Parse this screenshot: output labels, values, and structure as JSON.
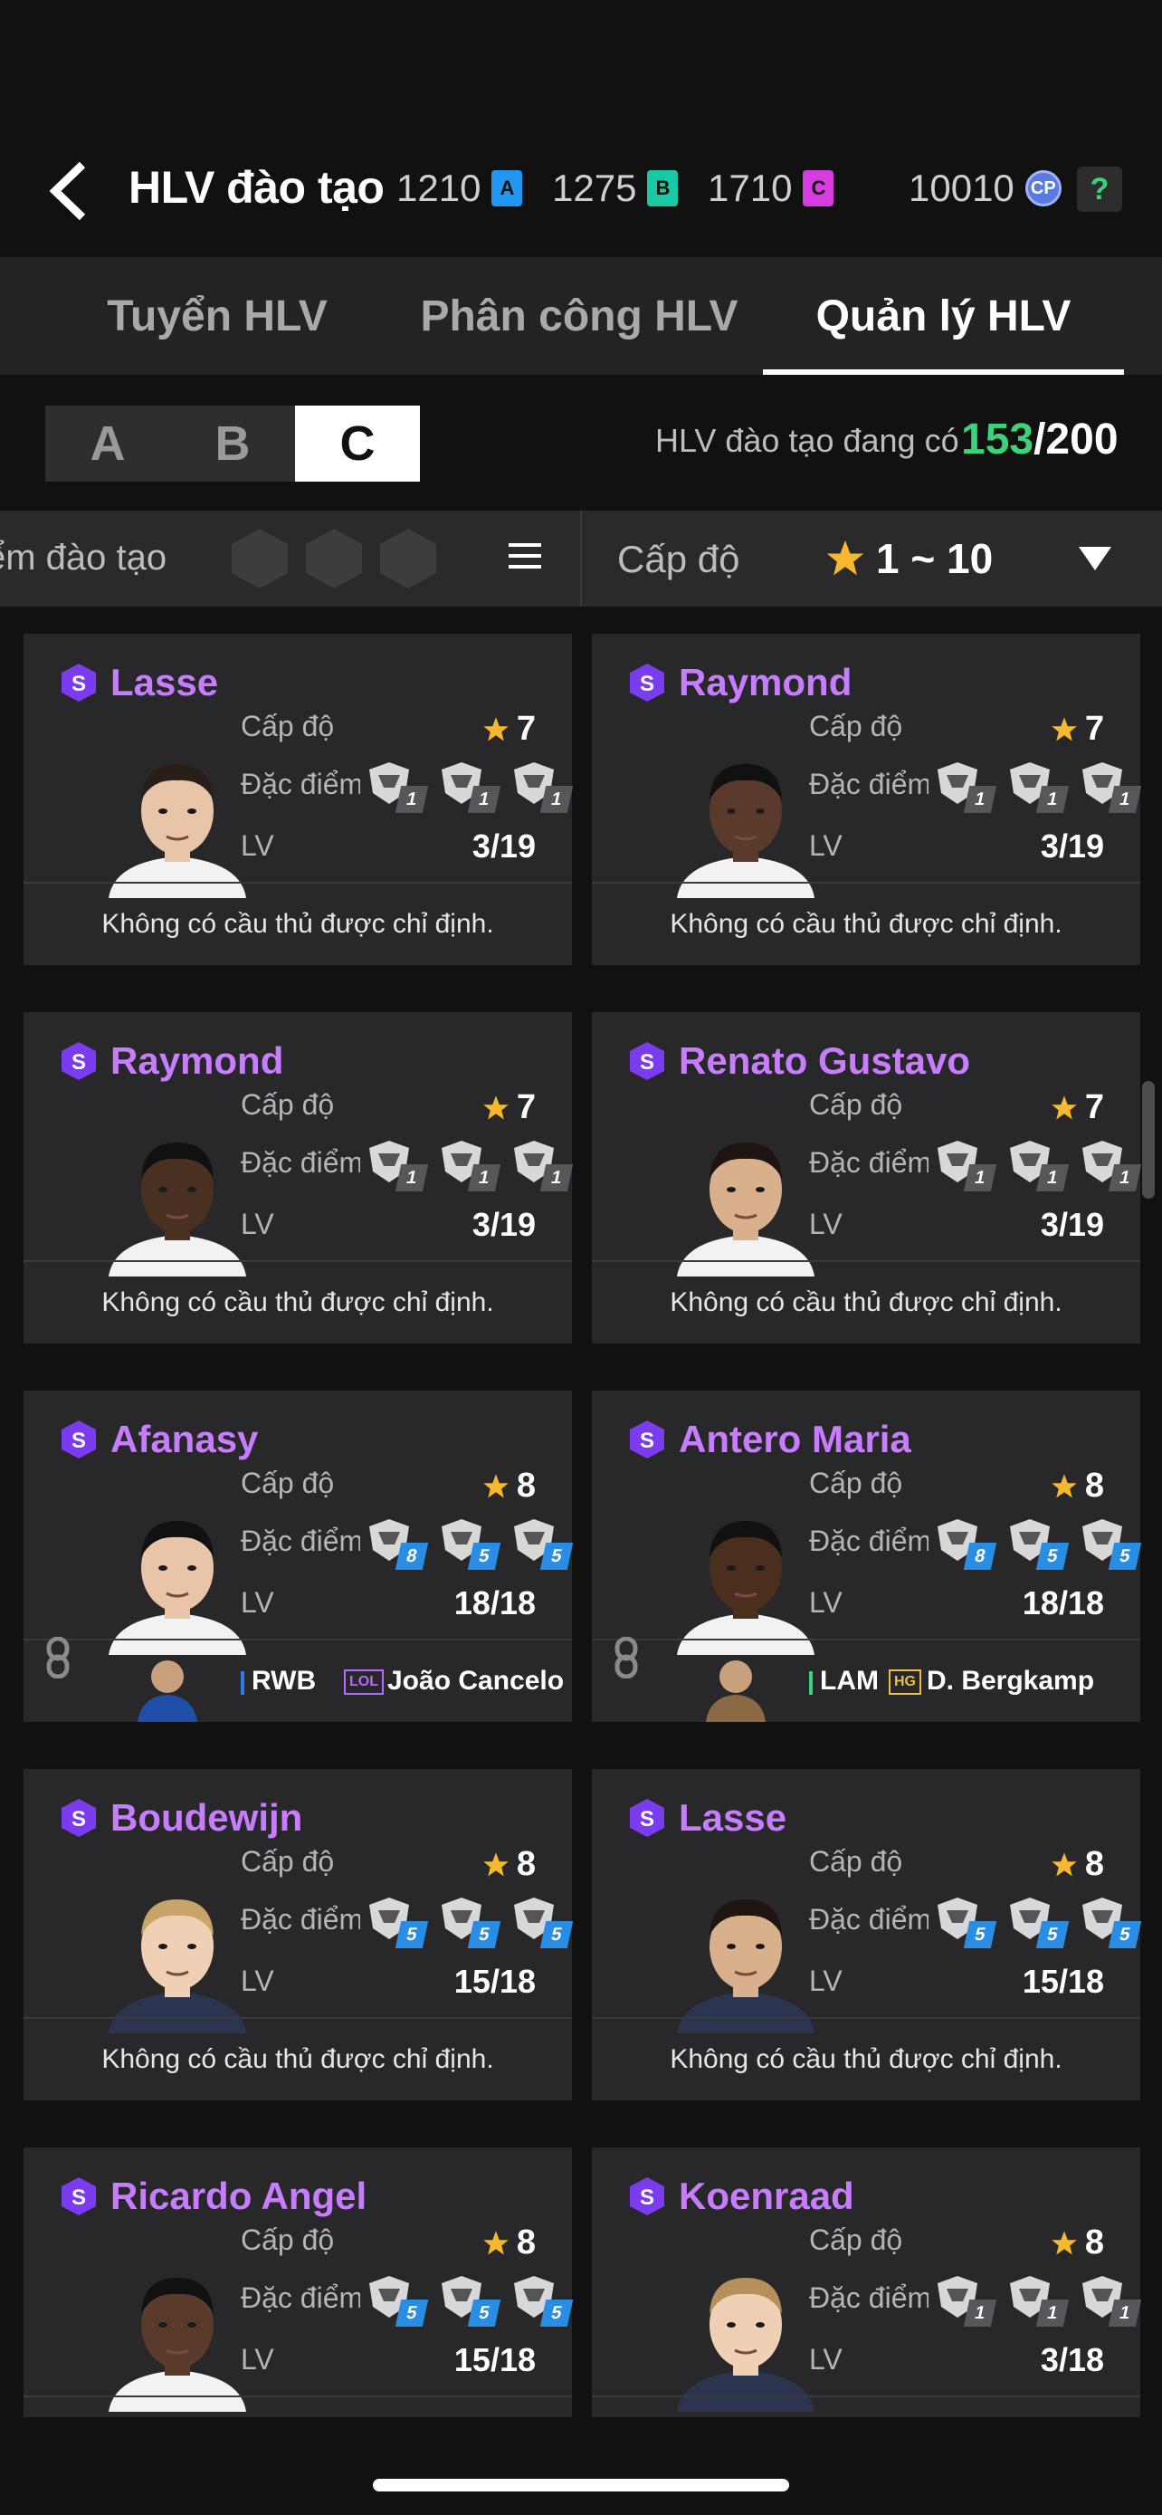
{
  "header": {
    "title": "HLV đào tạo",
    "currencies": [
      {
        "value": "1210",
        "badge": "A",
        "color": "#2196f3"
      },
      {
        "value": "1275",
        "badge": "B",
        "color": "#19c9a5"
      },
      {
        "value": "1710",
        "badge": "C",
        "color": "#d63ce0"
      },
      {
        "value": "10010",
        "badge": "CP",
        "color": "#5b7ae0"
      }
    ],
    "help": "?"
  },
  "tabs": [
    {
      "label": "Tuyển HLV",
      "active": false
    },
    {
      "label": "Phân công HLV",
      "active": false
    },
    {
      "label": "Quản lý HLV",
      "active": true
    }
  ],
  "grade_filter": {
    "options": [
      "A",
      "B",
      "C"
    ],
    "selected": "C"
  },
  "coach_count": {
    "label": "HLV đào tạo đang có",
    "current": "153",
    "max": "/200"
  },
  "filter": {
    "label": "ểm đào tạo",
    "level_label": "Cấp độ",
    "level_range": "1 ~ 10"
  },
  "stat_labels": {
    "level": "Cấp độ",
    "traits": "Đặc điểm",
    "lv": "LV"
  },
  "empty_assignment": "Không có cầu thủ được chỉ định.",
  "cards": [
    {
      "name": "Lasse",
      "level": "7",
      "lv": "3/19",
      "skills": [
        "1",
        "1",
        "1"
      ],
      "blue": false,
      "assigned": null
    },
    {
      "name": "Raymond",
      "level": "7",
      "lv": "3/19",
      "skills": [
        "1",
        "1",
        "1"
      ],
      "blue": false,
      "assigned": null
    },
    {
      "name": "Raymond",
      "level": "7",
      "lv": "3/19",
      "skills": [
        "1",
        "1",
        "1"
      ],
      "blue": false,
      "assigned": null
    },
    {
      "name": "Renato Gustavo",
      "level": "7",
      "lv": "3/19",
      "skills": [
        "1",
        "1",
        "1"
      ],
      "blue": false,
      "assigned": null
    },
    {
      "name": "Afanasy",
      "level": "8",
      "lv": "18/18",
      "skills": [
        "8",
        "5",
        "5"
      ],
      "blue": true,
      "assigned": {
        "position": "RWB",
        "pos_color": "#2f7ae8",
        "tag": "LOL",
        "tag_color": "#b36cff",
        "player": "João Cancelo"
      }
    },
    {
      "name": "Antero Maria",
      "level": "8",
      "lv": "18/18",
      "skills": [
        "8",
        "5",
        "5"
      ],
      "blue": true,
      "assigned": {
        "position": "LAM",
        "pos_color": "#3bd37a",
        "tag": "HG",
        "tag_color": "#e9c04a",
        "player": "D. Bergkamp"
      }
    },
    {
      "name": "Boudewijn",
      "level": "8",
      "lv": "15/18",
      "skills": [
        "5",
        "5",
        "5"
      ],
      "blue": true,
      "assigned": null
    },
    {
      "name": "Lasse",
      "level": "8",
      "lv": "15/18",
      "skills": [
        "5",
        "5",
        "5"
      ],
      "blue": true,
      "assigned": null
    },
    {
      "name": "Ricardo Angel",
      "level": "8",
      "lv": "15/18",
      "skills": [
        "5",
        "5",
        "5"
      ],
      "blue": true,
      "assigned": null
    },
    {
      "name": "Koenraad",
      "level": "8",
      "lv": "3/18",
      "skills": [
        "1",
        "1",
        "1"
      ],
      "blue": false,
      "assigned": null
    }
  ]
}
